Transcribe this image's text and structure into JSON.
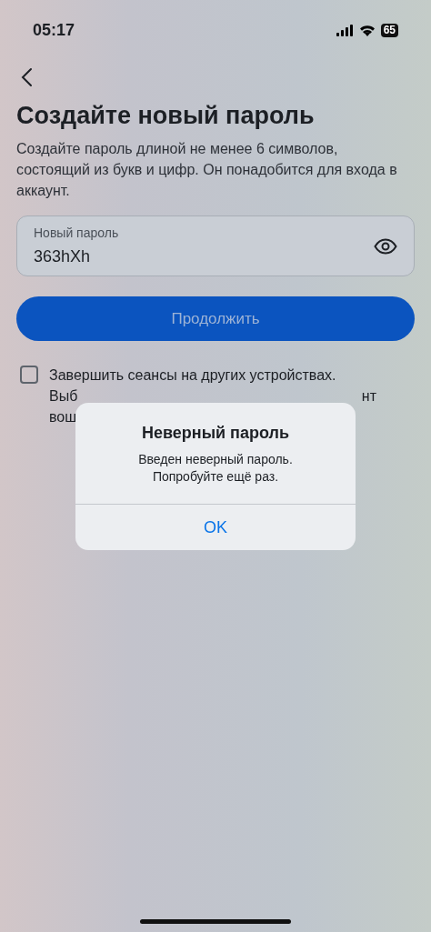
{
  "status_bar": {
    "time": "05:17",
    "battery": "65"
  },
  "title": "Создайте новый пароль",
  "description": "Создайте пароль длиной не менее 6 символов, состоящий из букв и цифр. Он понадобится для входа в аккаунт.",
  "password_field": {
    "label": "Новый пароль",
    "value": "363hXh"
  },
  "continue_button": "Продолжить",
  "sessions_checkbox": {
    "checked": false,
    "line_1": "Завершить сеансы на других устройствах.",
    "line_2_start": "Выб",
    "line_2_end": "нт",
    "line_3_start": "вош"
  },
  "alert": {
    "title": "Неверный пароль",
    "message_lines": [
      "Введен неверный пароль.",
      "Попробуйте ещё раз."
    ],
    "button": "OK"
  }
}
